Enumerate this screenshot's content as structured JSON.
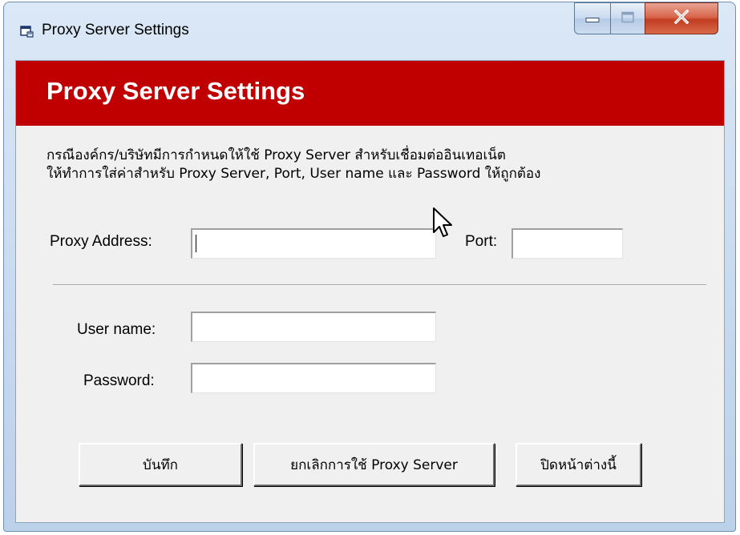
{
  "window": {
    "title": "Proxy Server Settings",
    "controls": {
      "minimize": "minimize",
      "maximize": "maximize",
      "close": "close"
    }
  },
  "banner": {
    "title": "Proxy Server Settings",
    "color": "#c00000"
  },
  "description": {
    "line1": "กรณีองค์กร/บริษัทมีการกำหนดให้ใช้ Proxy Server สำหรับเชื่อมต่ออินเทอเน็ต",
    "line2": "ให้ทำการใส่ค่าสำหรับ Proxy Server, Port, User name และ Password ให้ถูกต้อง"
  },
  "form": {
    "proxy_address": {
      "label": "Proxy Address:",
      "value": ""
    },
    "port": {
      "label": "Port:",
      "value": ""
    },
    "username": {
      "label": "User name:",
      "value": ""
    },
    "password": {
      "label": "Password:",
      "value": ""
    }
  },
  "buttons": {
    "save": "บันทึก",
    "cancel_proxy": "ยกเลิกการใช้ Proxy Server",
    "close_window": "ปิดหน้าต่างนี้"
  },
  "icons": {
    "app": "window-icon",
    "cursor": "mouse-pointer-icon"
  }
}
